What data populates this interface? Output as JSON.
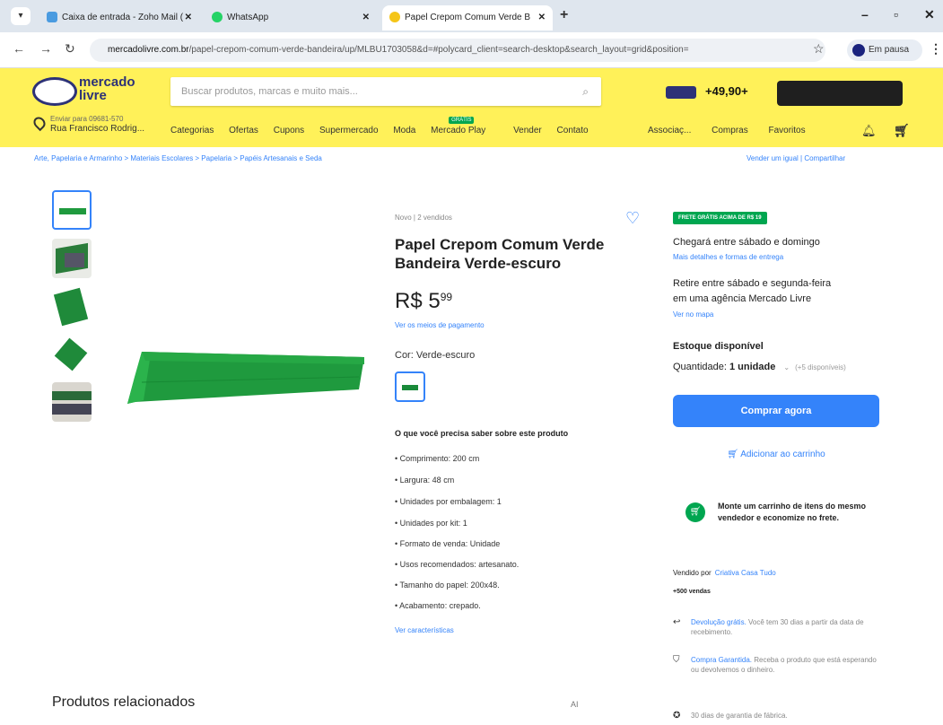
{
  "browser": {
    "tabs": [
      {
        "label": "Caixa de entrada - Zoho Mail (",
        "color": "#4a9be0"
      },
      {
        "label": "WhatsApp",
        "color": "#25d366"
      },
      {
        "label": "Papel Crepom Comum Verde B",
        "color": "#f5c518"
      }
    ],
    "url_host": "mercadolivre.com.br",
    "url_path": "/papel-crepom-comum-verde-bandeira/up/MLBU1703058&d=#polycard_client=search-desktop&search_layout=grid&position=",
    "profile_label": "Em pausa"
  },
  "header": {
    "logo_text": "mercado livre",
    "search_placeholder": "Buscar produtos, marcas e muito mais...",
    "promo_price": "+49,90+",
    "location_line1": "Enviar para 09681-570",
    "location_line2": "Rua Francisco Rodrig...",
    "nav": [
      "Categorias",
      "Ofertas",
      "Cupons",
      "Supermercado",
      "Moda",
      "Mercado Play",
      "Vender",
      "Contato"
    ],
    "new_tag": "GRÁTIS",
    "account": "Associaç...",
    "right_nav": [
      "Compras",
      "Favoritos"
    ]
  },
  "breadcrumb": "Arte, Papelaria e Armarinho > Materiais Escolares > Papelaria > Papéis Artesanais e Seda",
  "share": "Vender um igual  |  Compartilhar",
  "product": {
    "condition": "Novo  |  2 vendidos",
    "title": "Papel Crepom Comum Verde Bandeira Verde-escuro",
    "price_int": "R$ 5",
    "price_cents": "99",
    "payment_link": "Ver os meios de pagamento",
    "color_label": "Cor: Verde-escuro",
    "features_heading": "O que você precisa saber sobre este produto",
    "features": [
      "Comprimento: 200 cm",
      "Largura: 48 cm",
      "Unidades por embalagem: 1",
      "Unidades por kit: 1",
      "Formato de venda: Unidade",
      "Usos recomendados: artesanato.",
      "Tamanho do papel: 200x48.",
      "Acabamento: crepado."
    ],
    "more_features": "Ver características"
  },
  "buybox": {
    "frete_badge": "FRETE GRÁTIS ACIMA DE R$ 19",
    "delivery": "Chegará entre sábado e domingo",
    "delivery_link": "Mais detalhes e formas de entrega",
    "pickup_line1": "Retire entre sábado e segunda-feira",
    "pickup_line2": "em uma agência Mercado Livre",
    "pickup_link": "Ver no mapa",
    "stock": "Estoque disponível",
    "qty_label": "Quantidade:",
    "qty_value": "1 unidade",
    "qty_avail": "(+5 disponíveis)",
    "buy_button": "Comprar agora",
    "add_cart": "Adicionar ao carrinho",
    "cart_tip": "Monte um carrinho de itens do mesmo vendedor e economize no frete.",
    "seller_label": "Vendido por",
    "seller_name": "Criativa Casa Tudo",
    "sales": "+500 vendas",
    "guarantees": [
      {
        "hl": "Devolução grátis.",
        "text": " Você tem 30 dias a partir da data de recebimento."
      },
      {
        "hl": "Compra Garantida.",
        "text": " Receba o produto que está esperando ou devolvemos o dinheiro."
      },
      {
        "hl": "",
        "text": "30 dias de garantia de fábrica."
      }
    ]
  },
  "related_heading": "Produtos relacionados",
  "page_ai": "AI",
  "colors": {
    "ml_yellow": "#fff159",
    "ml_blue": "#3483fa",
    "ml_green": "#00a650",
    "paper_green": "#1f9a3e"
  }
}
